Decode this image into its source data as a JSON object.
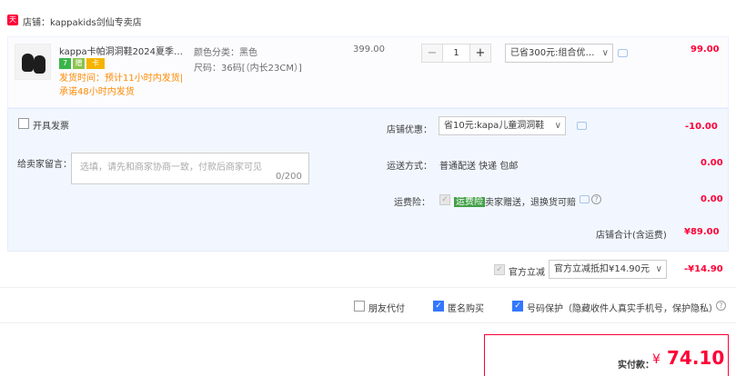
{
  "shop": {
    "icon_text": "天猫",
    "name": "店铺：kappakids剑仙专卖店"
  },
  "item": {
    "title": "kappa卡帕洞洞鞋2024夏季凉…",
    "badges": [
      "7",
      "赠",
      "卡"
    ],
    "ship_note": "发货时间：预计11小时内发货|承诺48小时内发货",
    "color_attr": "颜色分类：黑色",
    "size_attr": "尺码：36码[（内长23CM）]",
    "unit_price": "399.00",
    "quantity": "1",
    "minus": "−",
    "plus": "+",
    "discount_select": "已省300元:组合优…",
    "subtotal": "99.00"
  },
  "invoice": {
    "label": "开具发票"
  },
  "message": {
    "label": "给卖家留言：",
    "placeholder": "选填，请先和商家协商一致，付款后商家可见",
    "count": "0/200"
  },
  "shop_discount": {
    "label": "店铺优惠：",
    "select": "省10元:kapa儿童洞洞鞋",
    "amount": "-10.00"
  },
  "shipping": {
    "label": "运送方式：",
    "value": "普通配送 快递 包邮",
    "amount": "0.00"
  },
  "insurance": {
    "label": "运费险：",
    "tag": "运费险",
    "desc": "卖家赠送，退换货可赔",
    "amount": "0.00"
  },
  "shop_total": {
    "label": "店铺合计(含运费)",
    "amount": "¥89.00"
  },
  "official": {
    "label": "官方立减",
    "select": "官方立减抵扣¥14.90元",
    "amount": "-¥14.90"
  },
  "options": {
    "friend_pay": "朋友代付",
    "anonymous": "匿名购买",
    "privacy": "号码保护（隐藏收件人真实手机号，保护隐私）"
  },
  "payment": {
    "label": "实付款：",
    "currency": "¥",
    "amount": "74.10"
  },
  "colors": {
    "accent_red": "#ff0036",
    "check_blue": "#3377ff",
    "ship_orange": "#ff8a00"
  }
}
